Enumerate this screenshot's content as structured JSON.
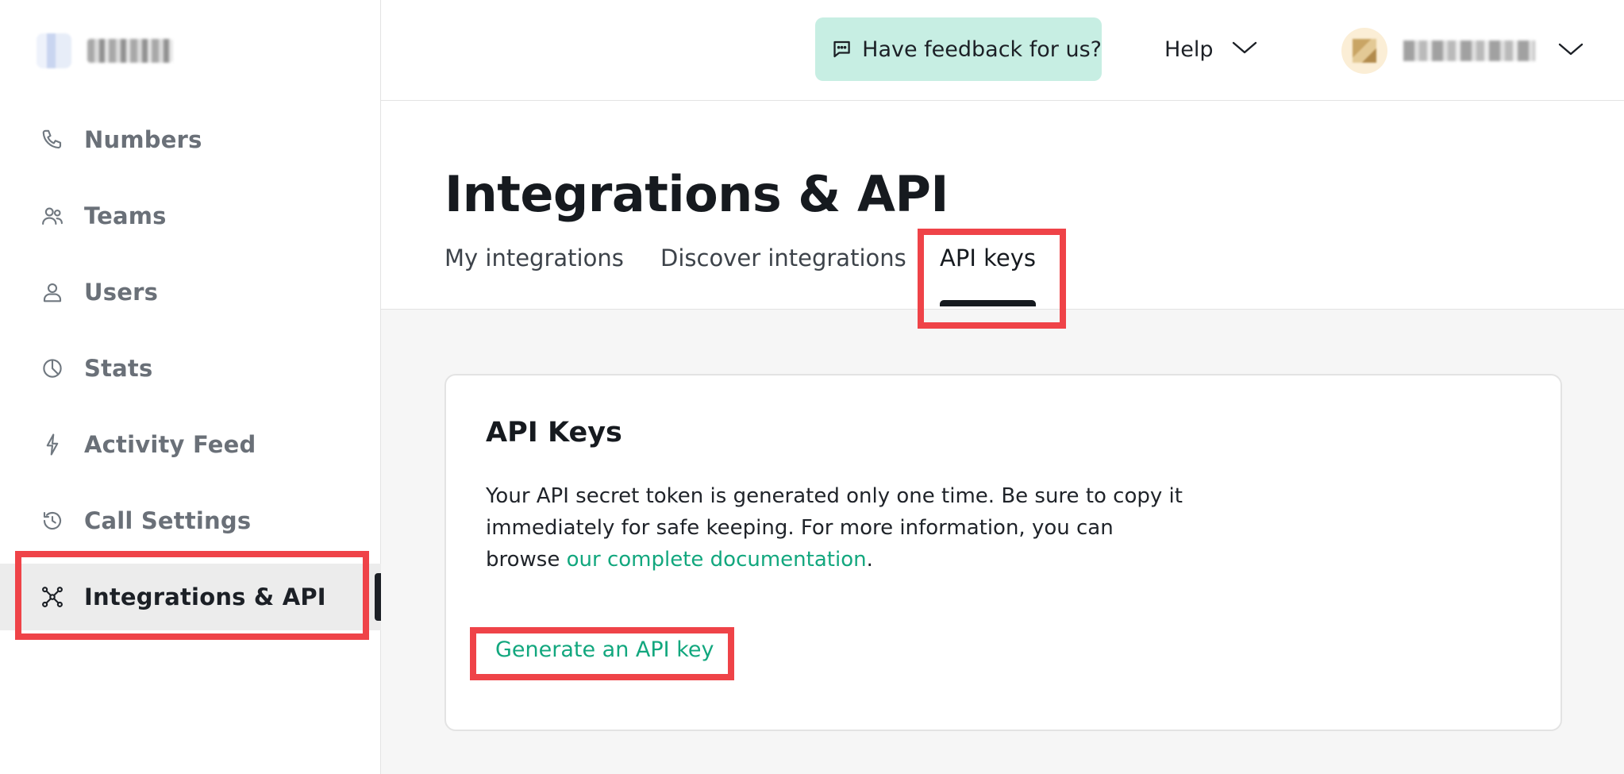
{
  "sidebar": {
    "items": [
      {
        "key": "numbers",
        "label": "Numbers",
        "icon": "phone-icon"
      },
      {
        "key": "teams",
        "label": "Teams",
        "icon": "team-icon"
      },
      {
        "key": "users",
        "label": "Users",
        "icon": "user-icon"
      },
      {
        "key": "stats",
        "label": "Stats",
        "icon": "pie-chart-icon"
      },
      {
        "key": "activity-feed",
        "label": "Activity Feed",
        "icon": "lightning-icon"
      },
      {
        "key": "call-settings",
        "label": "Call Settings",
        "icon": "history-icon"
      },
      {
        "key": "integrations",
        "label": "Integrations & API",
        "icon": "network-icon",
        "active": true
      }
    ]
  },
  "header": {
    "feedback_label": "Have feedback for us?",
    "help_label": "Help"
  },
  "page": {
    "title": "Integrations & API",
    "tabs": [
      {
        "label": "My integrations"
      },
      {
        "label": "Discover integrations"
      },
      {
        "label": "API keys",
        "active": true
      }
    ]
  },
  "card": {
    "title": "API Keys",
    "body_prefix": "Your API secret token is generated only one time. Be sure to copy it immediately for safe keeping. For more information, you can browse ",
    "doc_link": "our complete documentation",
    "body_suffix": ".",
    "generate_label": "Generate an API key"
  },
  "colors": {
    "accent_green": "#12a77e",
    "feedback_bg": "#c7eee3",
    "highlight_red": "#ef4348"
  }
}
